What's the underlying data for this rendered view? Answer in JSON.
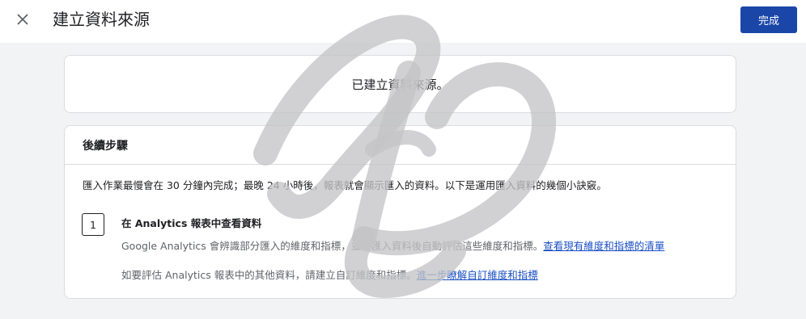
{
  "header": {
    "close_icon": "close-icon",
    "title": "建立資料來源",
    "done_label": "完成"
  },
  "created_card": {
    "message": "已建立資料來源。"
  },
  "next_steps": {
    "heading": "後續步驟",
    "intro": "匯入作業最慢會在 30 分鐘內完成；最晚 24 小時後，報表就會顯示匯入的資料。以下是運用匯入資料的幾個小訣竅。",
    "steps": [
      {
        "number": "1",
        "title": "在 Analytics 報表中查看資料",
        "line1_text": "Google Analytics 會辨識部分匯入的維度和指標，並在匯入資料後自動評估這些維度和指標。",
        "line1_link": "查看現有維度和指標的清單",
        "line2_text": "如要評估 Analytics 報表中的其他資料，請建立自訂維度和指標。",
        "line2_link": "進一步瞭解自訂維度和指標"
      }
    ]
  },
  "watermark_icon": "script-letters-watermark",
  "colors": {
    "primary_button": "#1a46a8",
    "link": "#1a4fc4",
    "background": "#f1f3f4"
  }
}
